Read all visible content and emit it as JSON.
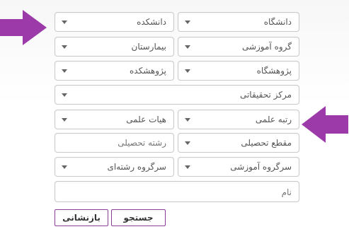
{
  "form": {
    "university": "دانشگاه",
    "faculty": "دانشکده",
    "education_group": "گروه آموزشی",
    "hospital": "بیمارستان",
    "research_institute": "پژوهشگاه",
    "research_college": "پژوهشکده",
    "research_center": "مرکز تحقیقاتی",
    "academic_rank": "رتبه علمی",
    "faculty_board": "هیات علمی",
    "degree_level": "مقطع تحصیلی",
    "field_of_study_placeholder": "رشته تحصیلی",
    "education_head_group": "سرگروه آموزشی",
    "field_head_group": "سرگروه رشته‌ای",
    "name_placeholder": "نام"
  },
  "buttons": {
    "search": "جستجو",
    "reset": "بازنشانی"
  },
  "colors": {
    "accent": "#8a3f97",
    "pointer": "#9b3aa8"
  }
}
